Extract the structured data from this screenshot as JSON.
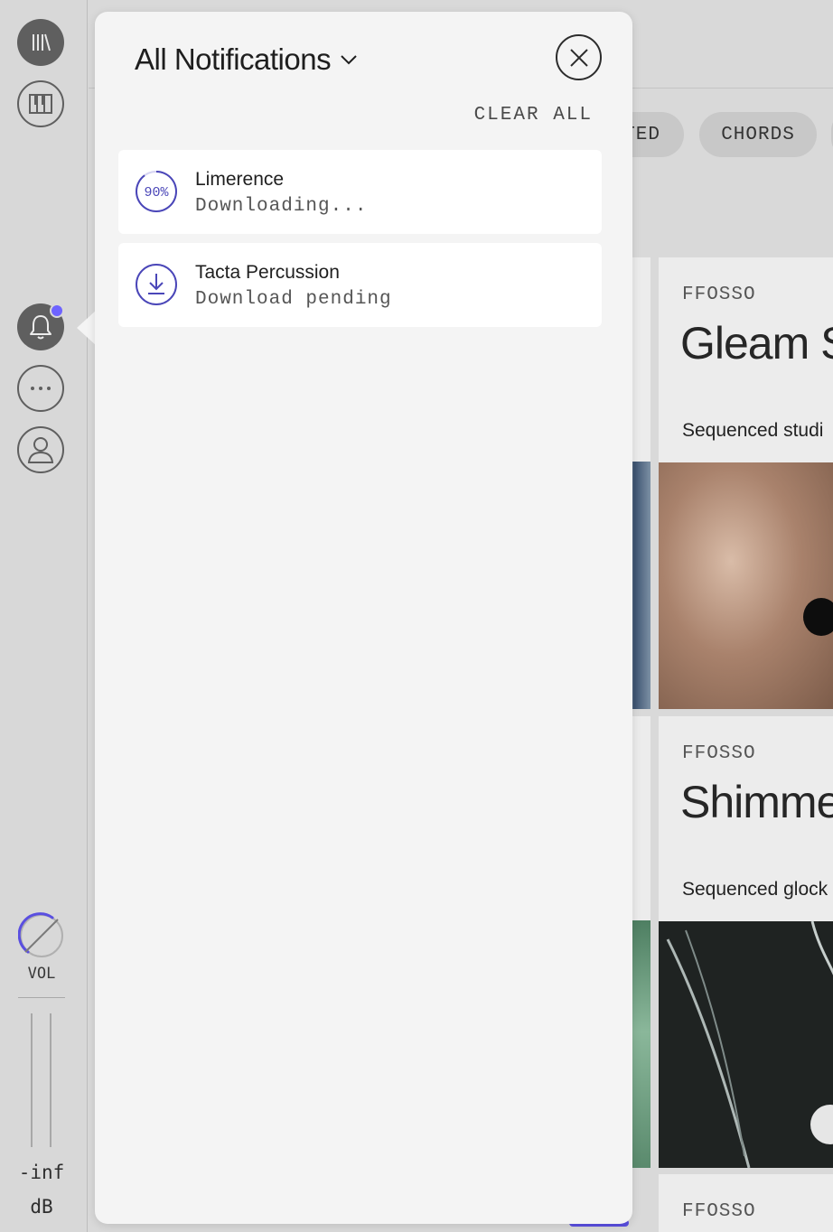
{
  "sidebar": {
    "items": [
      {
        "name": "library",
        "icon": "library-icon"
      },
      {
        "name": "keyboard",
        "icon": "piano-icon"
      },
      {
        "name": "notifications",
        "icon": "bell-icon",
        "has_unread": true
      },
      {
        "name": "more",
        "icon": "more-icon"
      },
      {
        "name": "account",
        "icon": "user-icon"
      }
    ],
    "volume": {
      "label": "VOL",
      "level": "-inf",
      "unit": "dB"
    }
  },
  "filters": {
    "chips": [
      "TED",
      "CHORDS"
    ]
  },
  "cards": [
    {
      "brand": "FFOSSO",
      "title": "Gleam S",
      "description": "Sequenced studi"
    },
    {
      "brand": "FFOSSO",
      "title": "Shimme",
      "description": "Sequenced glock"
    },
    {
      "brand": "FFOSSO"
    }
  ],
  "notifications_panel": {
    "title": "All Notifications",
    "clear_all_label": "CLEAR ALL",
    "items": [
      {
        "name": "Limerence",
        "status": "Downloading...",
        "progress_percent": 90,
        "progress_label": "90%"
      },
      {
        "name": "Tacta Percussion",
        "status": "Download pending",
        "icon": "download-icon"
      }
    ]
  },
  "colors": {
    "accent": "#6e63ff",
    "progress": "#4a46b8",
    "panel_bg": "#f4f4f4"
  }
}
